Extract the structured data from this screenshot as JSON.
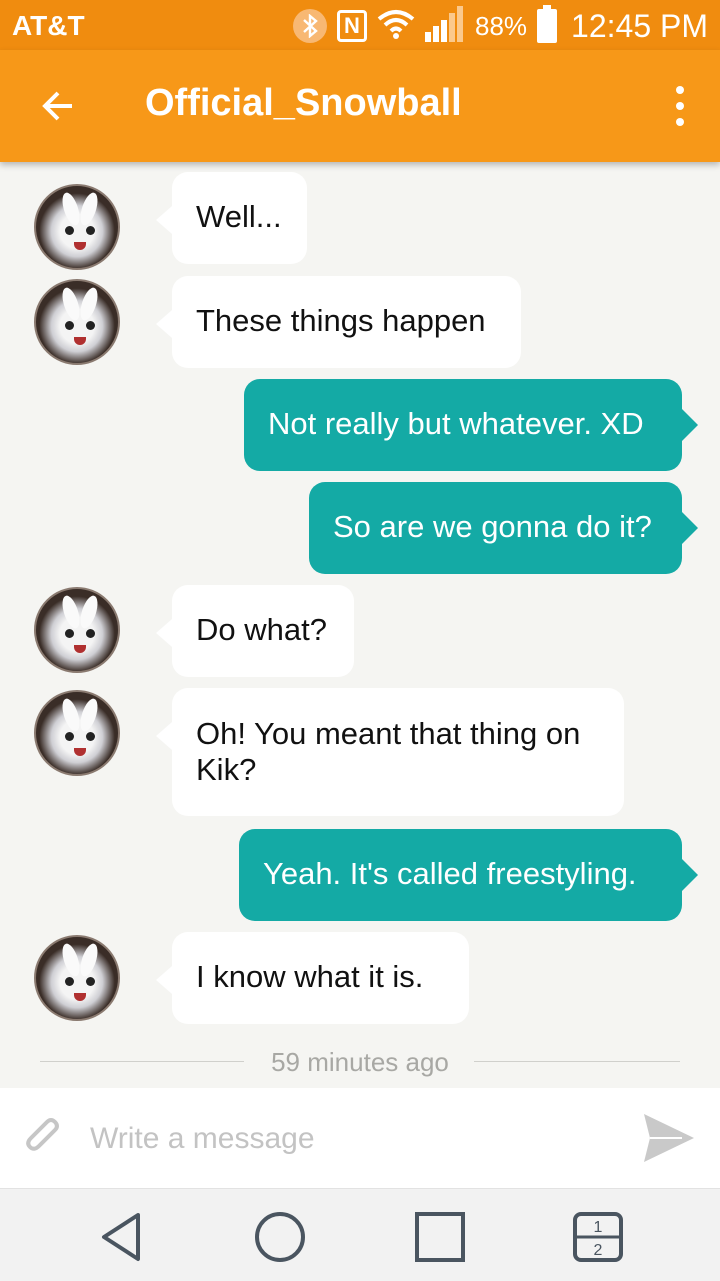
{
  "status_bar": {
    "carrier": "AT&T",
    "bluetooth_icon": "bluetooth-icon",
    "nfc_label": "N",
    "battery_percent": "88%",
    "time": "12:45 PM"
  },
  "app_bar": {
    "back_icon": "arrow-left-icon",
    "title": "Official_Snowball",
    "menu_icon": "more-vertical-icon",
    "color": "#f79818"
  },
  "messages": [
    {
      "direction": "in",
      "text": "Well..."
    },
    {
      "direction": "in",
      "text": "These things happen"
    },
    {
      "direction": "out",
      "text": "Not really but whatever. XD"
    },
    {
      "direction": "out",
      "text": "So are we gonna do it?"
    },
    {
      "direction": "in",
      "text": "Do what?"
    },
    {
      "direction": "in",
      "text": "Oh! You meant that thing on Kik?"
    },
    {
      "direction": "out",
      "text": "Yeah. It's called freestyling."
    },
    {
      "direction": "in",
      "text": "I know what it is."
    }
  ],
  "timestamp": "59 minutes ago",
  "composer": {
    "placeholder": "Write a message",
    "attach_icon": "paperclip-icon",
    "send_icon": "send-icon"
  },
  "nav_bar": {
    "back_icon": "nav-back-icon",
    "home_icon": "nav-home-icon",
    "recents_icon": "nav-recents-icon",
    "dual_window_icon": "dual-window-icon",
    "dual_top": "1",
    "dual_bottom": "2"
  },
  "colors": {
    "status_bar": "#f08c0f",
    "incoming_bubble": "#ffffff",
    "outgoing_bubble": "#14aaa5",
    "background": "#f5f5f2"
  }
}
